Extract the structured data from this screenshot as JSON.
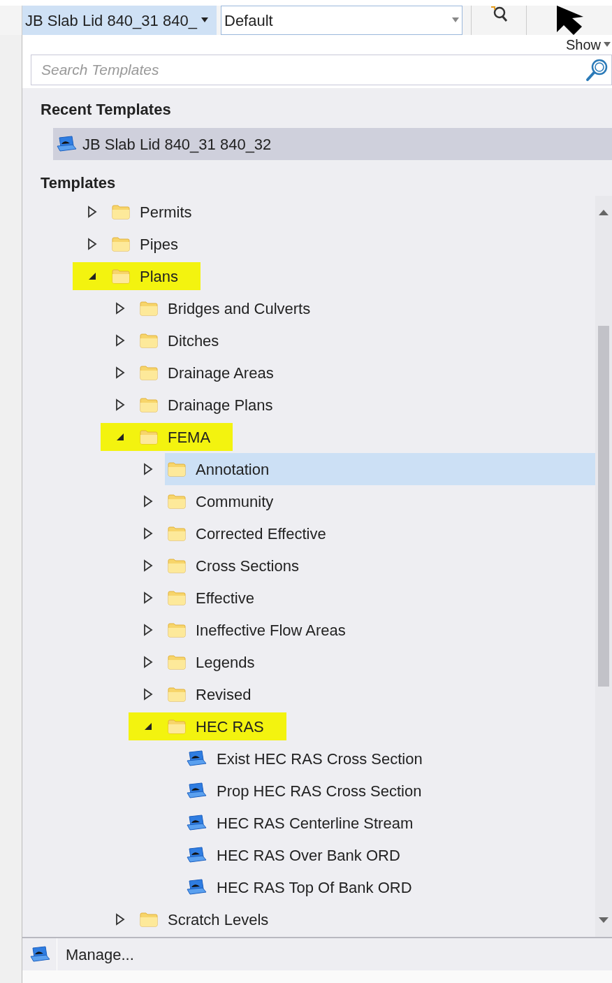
{
  "toolbar": {
    "template_combo": "JB Slab Lid 840_31  840_",
    "level_combo": "Default"
  },
  "show_menu": "Show",
  "search": {
    "placeholder": "Search Templates"
  },
  "recent": {
    "heading": "Recent Templates",
    "items": [
      {
        "label": "JB Slab Lid 840_31  840_32",
        "selected": true
      }
    ]
  },
  "templates": {
    "heading": "Templates",
    "tree": [
      {
        "kind": "folder",
        "label": "Permits",
        "expanded": false,
        "highlighted": false,
        "selected": false
      },
      {
        "kind": "folder",
        "label": "Pipes",
        "expanded": false,
        "highlighted": false,
        "selected": false
      },
      {
        "kind": "folder",
        "label": "Plans",
        "expanded": true,
        "highlighted": true,
        "selected": false,
        "children": [
          {
            "kind": "folder",
            "label": "Bridges and Culverts",
            "expanded": false,
            "highlighted": false,
            "selected": false
          },
          {
            "kind": "folder",
            "label": "Ditches",
            "expanded": false,
            "highlighted": false,
            "selected": false
          },
          {
            "kind": "folder",
            "label": "Drainage Areas",
            "expanded": false,
            "highlighted": false,
            "selected": false
          },
          {
            "kind": "folder",
            "label": "Drainage Plans",
            "expanded": false,
            "highlighted": false,
            "selected": false
          },
          {
            "kind": "folder",
            "label": "FEMA",
            "expanded": true,
            "highlighted": true,
            "selected": false,
            "children": [
              {
                "kind": "folder",
                "label": "Annotation",
                "expanded": false,
                "highlighted": false,
                "selected": true
              },
              {
                "kind": "folder",
                "label": "Community",
                "expanded": false,
                "highlighted": false,
                "selected": false
              },
              {
                "kind": "folder",
                "label": "Corrected Effective",
                "expanded": false,
                "highlighted": false,
                "selected": false
              },
              {
                "kind": "folder",
                "label": "Cross Sections",
                "expanded": false,
                "highlighted": false,
                "selected": false
              },
              {
                "kind": "folder",
                "label": "Effective",
                "expanded": false,
                "highlighted": false,
                "selected": false
              },
              {
                "kind": "folder",
                "label": "Ineffective Flow Areas",
                "expanded": false,
                "highlighted": false,
                "selected": false
              },
              {
                "kind": "folder",
                "label": "Legends",
                "expanded": false,
                "highlighted": false,
                "selected": false
              },
              {
                "kind": "folder",
                "label": "Revised",
                "expanded": false,
                "highlighted": false,
                "selected": false
              },
              {
                "kind": "folder",
                "label": "HEC RAS",
                "expanded": true,
                "highlighted": true,
                "selected": false,
                "children": [
                  {
                    "kind": "template",
                    "label": "Exist HEC RAS Cross Section",
                    "highlighted": false,
                    "selected": false
                  },
                  {
                    "kind": "template",
                    "label": "Prop HEC RAS Cross Section",
                    "highlighted": false,
                    "selected": false
                  },
                  {
                    "kind": "template",
                    "label": "HEC RAS Centerline Stream",
                    "highlighted": false,
                    "selected": false
                  },
                  {
                    "kind": "template",
                    "label": "HEC RAS Over Bank ORD",
                    "highlighted": false,
                    "selected": false
                  },
                  {
                    "kind": "template",
                    "label": "HEC RAS Top Of Bank ORD",
                    "highlighted": false,
                    "selected": false
                  }
                ]
              }
            ]
          },
          {
            "kind": "folder",
            "label": "Scratch Levels",
            "expanded": false,
            "highlighted": false,
            "selected": false
          }
        ]
      }
    ]
  },
  "manage": "Manage..."
}
